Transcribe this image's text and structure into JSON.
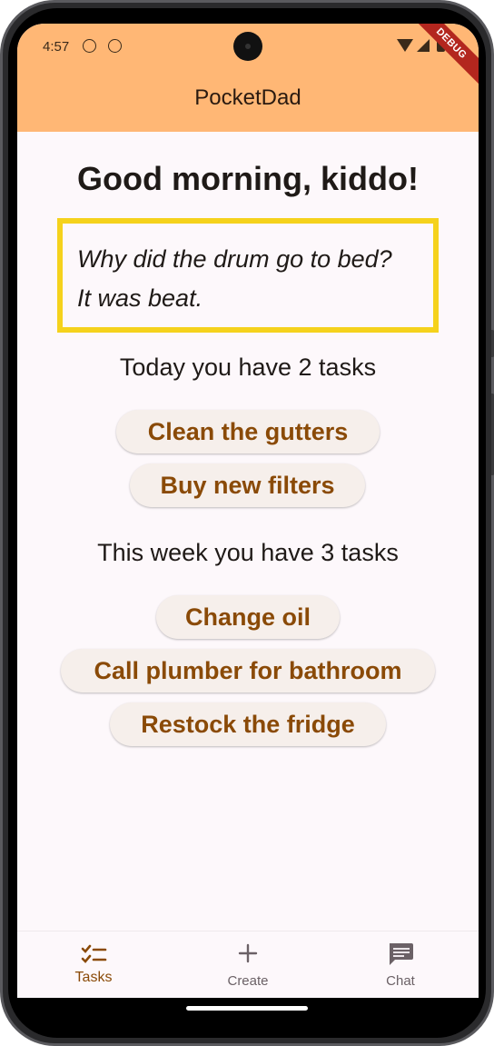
{
  "status_bar": {
    "time": "4:57",
    "debug_label": "DEBUG"
  },
  "app_bar": {
    "title": "PocketDad"
  },
  "greeting": "Good morning, kiddo!",
  "joke": {
    "line1": "Why did the drum go to bed?",
    "line2": "It was beat."
  },
  "today": {
    "heading": "Today you have 2 tasks",
    "tasks": [
      "Clean the gutters",
      "Buy new filters"
    ]
  },
  "week": {
    "heading": "This week you have 3 tasks",
    "tasks": [
      "Change oil",
      "Call plumber for bathroom",
      "Restock the fridge"
    ]
  },
  "nav": {
    "items": [
      {
        "label": "Tasks",
        "icon": "checklist-icon",
        "active": true
      },
      {
        "label": "Create",
        "icon": "plus-icon",
        "active": false
      },
      {
        "label": "Chat",
        "icon": "chat-bubble-icon",
        "active": false
      }
    ]
  },
  "colors": {
    "app_bar": "#ffb775",
    "accent": "#8a4a07",
    "joke_border": "#f5d21c",
    "inactive": "#6b6166"
  }
}
